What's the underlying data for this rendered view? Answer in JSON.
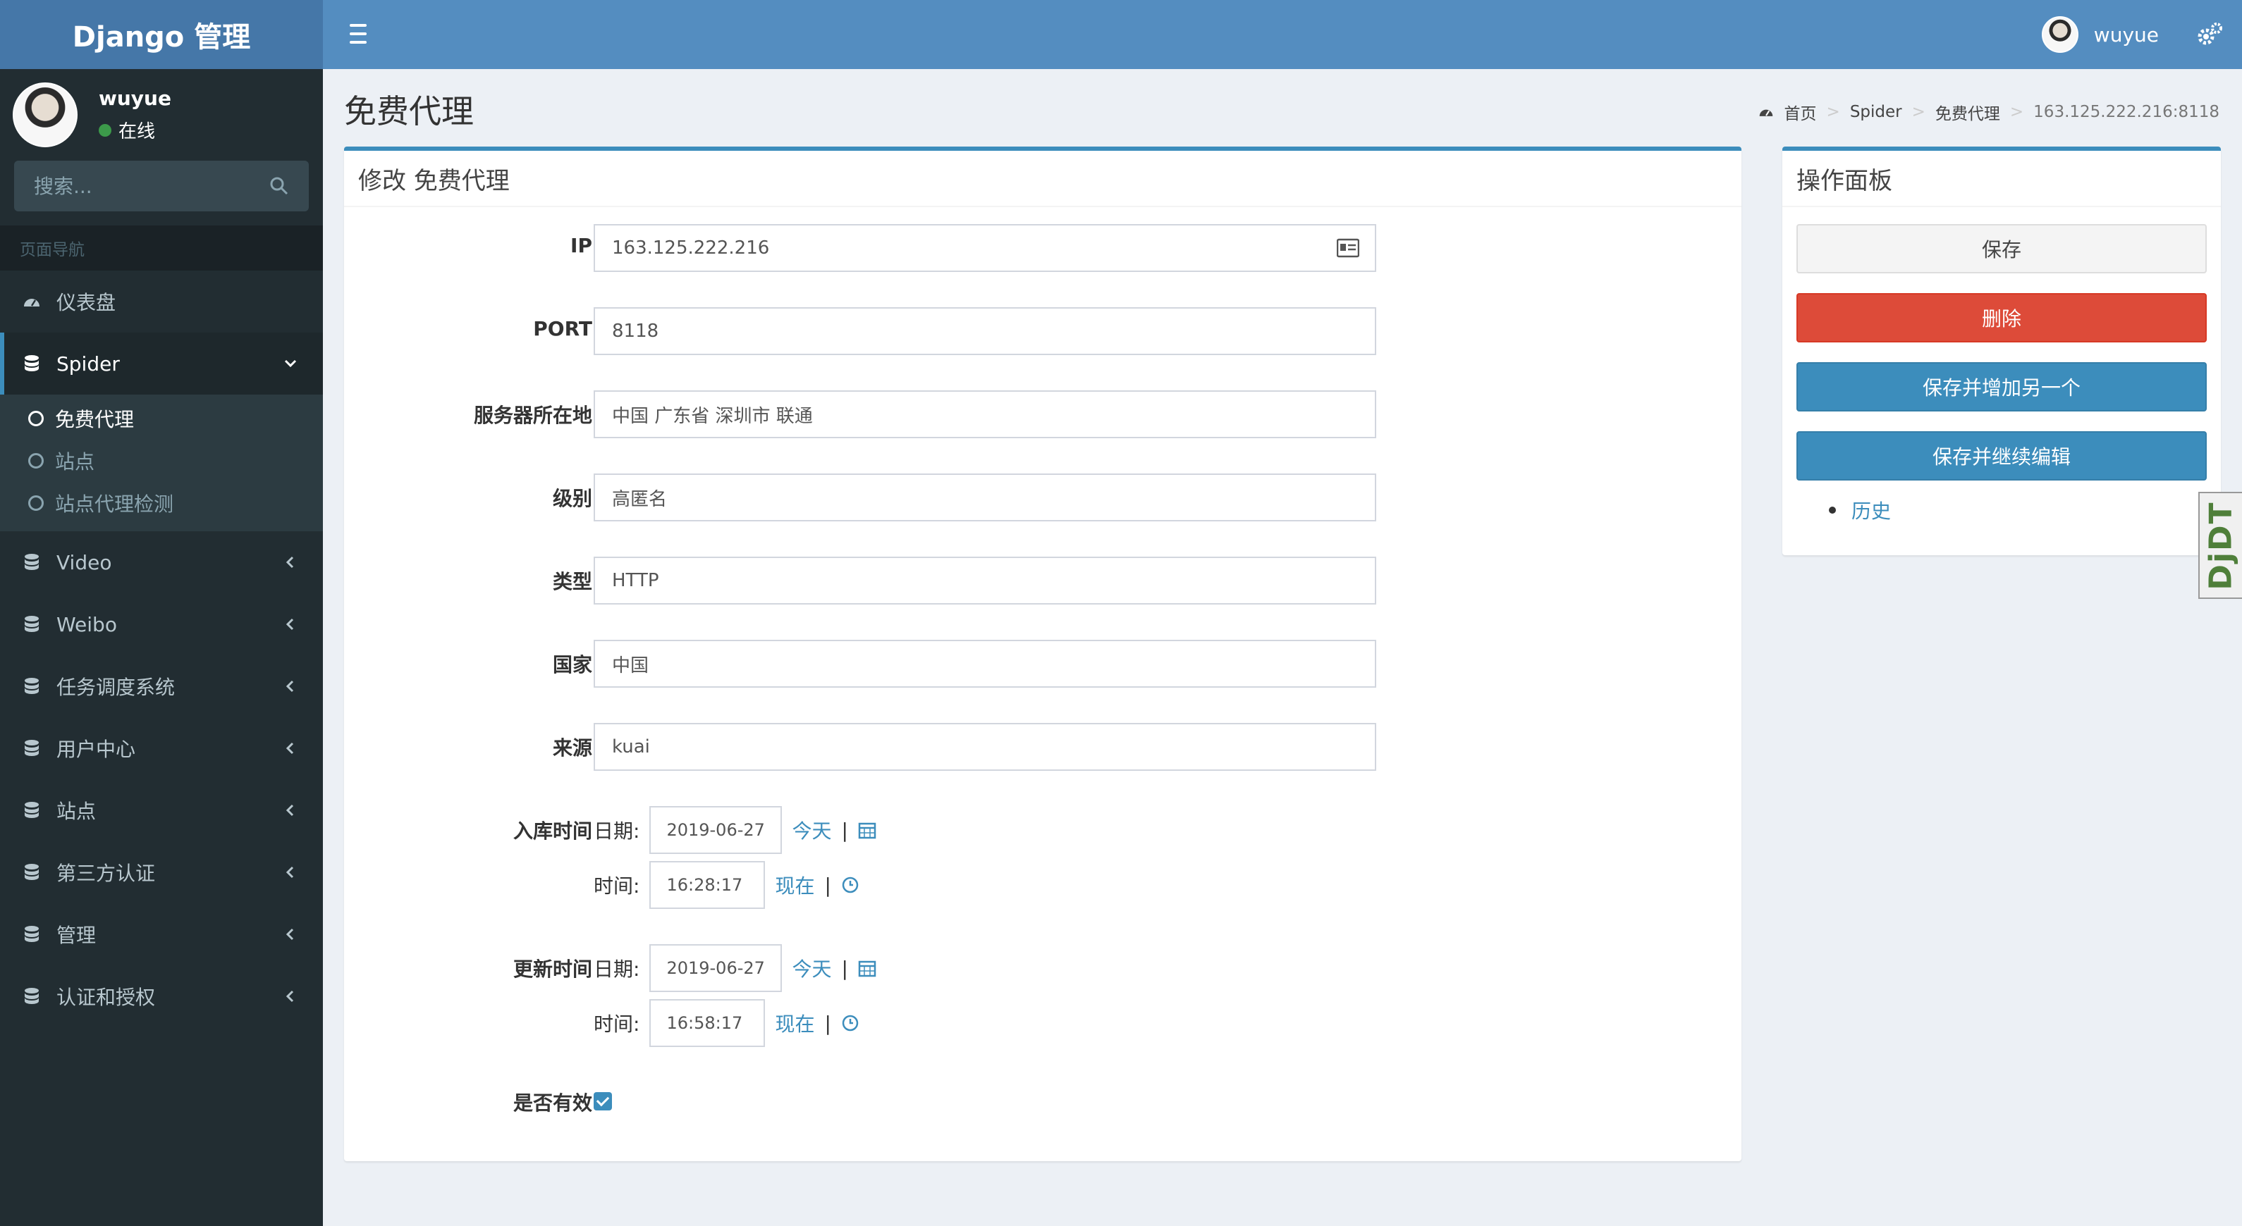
{
  "app": {
    "logo": "Django 管理"
  },
  "topbar": {
    "username": "wuyue"
  },
  "sidebar": {
    "user": {
      "name": "wuyue",
      "status": "在线"
    },
    "search_placeholder": "搜索...",
    "section_header": "页面导航",
    "items": [
      {
        "label": "仪表盘"
      },
      {
        "label": "Spider"
      },
      {
        "label": "Video"
      },
      {
        "label": "Weibo"
      },
      {
        "label": "任务调度系统"
      },
      {
        "label": "用户中心"
      },
      {
        "label": "站点"
      },
      {
        "label": "第三方认证"
      },
      {
        "label": "管理"
      },
      {
        "label": "认证和授权"
      }
    ],
    "subitems": [
      {
        "label": "免费代理"
      },
      {
        "label": "站点"
      },
      {
        "label": "站点代理检测"
      }
    ]
  },
  "page": {
    "title": "免费代理",
    "breadcrumb": [
      "首页",
      "Spider",
      "免费代理",
      "163.125.222.216:8118"
    ]
  },
  "form": {
    "title": "修改 免费代理",
    "fields": [
      {
        "label": "IP",
        "value": "163.125.222.216"
      },
      {
        "label": "PORT",
        "value": "8118"
      },
      {
        "label": "服务器所在地",
        "value": "中国 广东省 深圳市 联通"
      },
      {
        "label": "级别",
        "value": "高匿名"
      },
      {
        "label": "类型",
        "value": "HTTP"
      },
      {
        "label": "国家",
        "value": "中国"
      },
      {
        "label": "来源",
        "value": "kuai"
      }
    ],
    "datetimes": [
      {
        "label": "入库时间",
        "date_label": "日期:",
        "date": "2019-06-27",
        "today": "今天",
        "time_label": "时间:",
        "time": "16:28:17",
        "now": "现在"
      },
      {
        "label": "更新时间",
        "date_label": "日期:",
        "date": "2019-06-27",
        "today": "今天",
        "time_label": "时间:",
        "time": "16:58:17",
        "now": "现在"
      }
    ],
    "valid": {
      "label": "是否有效",
      "checked": true
    }
  },
  "panel": {
    "title": "操作面板",
    "save": "保存",
    "delete": "删除",
    "save_add": "保存并增加另一个",
    "save_continue": "保存并继续编辑",
    "history": "历史"
  },
  "overlay": {
    "ddt": "DjDT"
  }
}
